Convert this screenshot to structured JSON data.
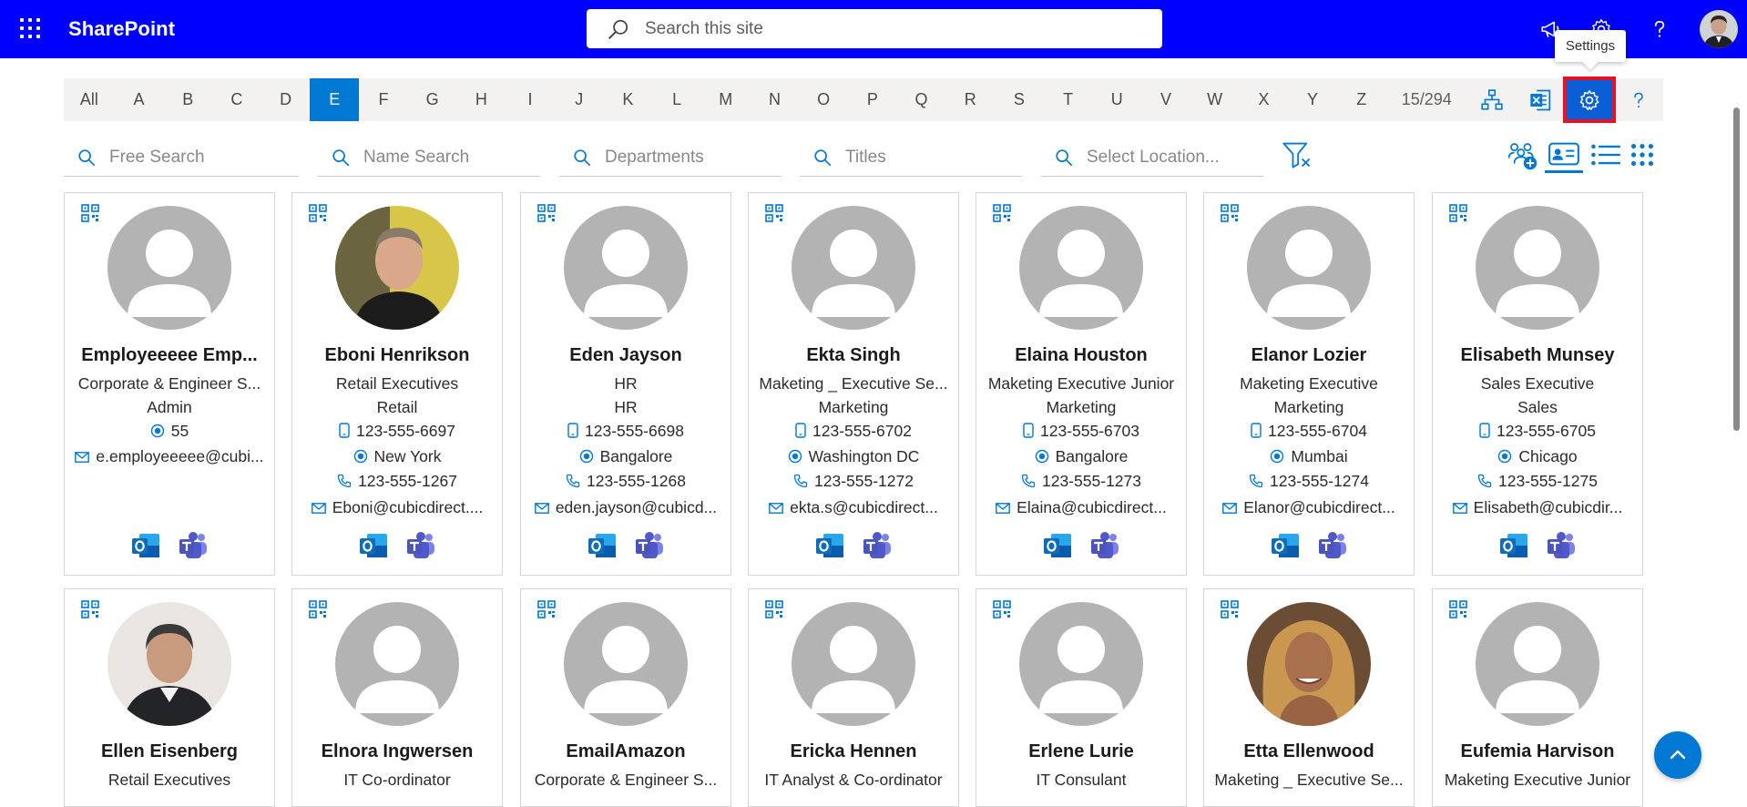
{
  "suitebar": {
    "app_name": "SharePoint",
    "search_placeholder": "Search this site",
    "tooltip": "Settings",
    "color": "#0000ff"
  },
  "alphabet": {
    "all_label": "All",
    "letters": [
      "A",
      "B",
      "C",
      "D",
      "E",
      "F",
      "G",
      "H",
      "I",
      "J",
      "K",
      "L",
      "M",
      "N",
      "O",
      "P",
      "Q",
      "R",
      "S",
      "T",
      "U",
      "V",
      "W",
      "X",
      "Y",
      "Z"
    ],
    "active_letter": "E",
    "count": "15/294"
  },
  "filters": {
    "free_search": "Free Search",
    "name_search": "Name Search",
    "departments": "Departments",
    "titles": "Titles",
    "location": "Select Location..."
  },
  "employees_row1": [
    {
      "name": "Employeeeee Emp...",
      "title": "Corporate & Engineer S...",
      "department": "Admin",
      "location": "55",
      "email": "e.employeeeee@cubi..."
    },
    {
      "name": "Eboni Henrikson",
      "title": "Retail Executives",
      "department": "Retail",
      "phone": "123-555-6697",
      "location": "New York",
      "office_phone": "123-555-1267",
      "email": "Eboni@cubicdirect...."
    },
    {
      "name": "Eden Jayson",
      "title": "HR",
      "department": "HR",
      "phone": "123-555-6698",
      "location": "Bangalore",
      "office_phone": "123-555-1268",
      "email": "eden.jayson@cubicd..."
    },
    {
      "name": "Ekta Singh",
      "title": "Maketing _ Executive Se...",
      "department": "Marketing",
      "phone": "123-555-6702",
      "location": "Washington DC",
      "office_phone": "123-555-1272",
      "email": "ekta.s@cubicdirect..."
    },
    {
      "name": "Elaina Houston",
      "title": "Maketing Executive Junior",
      "department": "Marketing",
      "phone": "123-555-6703",
      "location": "Bangalore",
      "office_phone": "123-555-1273",
      "email": "Elaina@cubicdirect..."
    },
    {
      "name": "Elanor Lozier",
      "title": "Maketing Executive",
      "department": "Marketing",
      "phone": "123-555-6704",
      "location": "Mumbai",
      "office_phone": "123-555-1274",
      "email": "Elanor@cubicdirect..."
    },
    {
      "name": "Elisabeth Munsey",
      "title": "Sales Executive",
      "department": "Sales",
      "phone": "123-555-6705",
      "location": "Chicago",
      "office_phone": "123-555-1275",
      "email": "Elisabeth@cubicdir..."
    }
  ],
  "employees_row2": [
    {
      "name": "Ellen Eisenberg",
      "title": "Retail Executives"
    },
    {
      "name": "Elnora Ingwersen",
      "title": "IT Co-ordinator"
    },
    {
      "name": "EmailAmazon",
      "title": "Corporate & Engineer S..."
    },
    {
      "name": "Ericka Hennen",
      "title": "IT Analyst & Co-ordinator"
    },
    {
      "name": "Erlene Lurie",
      "title": "IT Consulant"
    },
    {
      "name": "Etta Ellenwood",
      "title": "Maketing _ Executive Se..."
    },
    {
      "name": "Eufemia Harvison",
      "title": "Maketing Executive Junior"
    }
  ]
}
